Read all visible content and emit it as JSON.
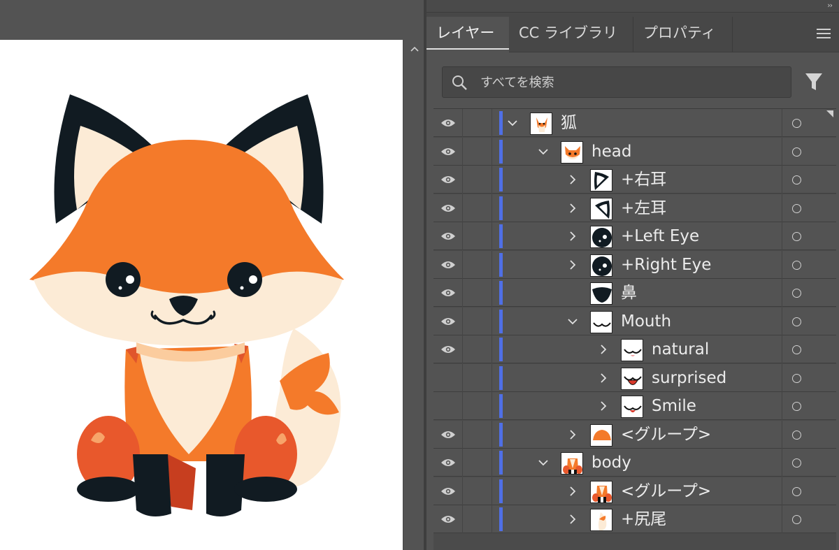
{
  "panel": {
    "tabs": [
      {
        "label": "レイヤー",
        "active": true
      },
      {
        "label": "CC ライブラリ",
        "active": false
      },
      {
        "label": "プロパティ",
        "active": false
      }
    ]
  },
  "search": {
    "placeholder": "すべてを検索"
  },
  "colors": {
    "layer_color": "#4f6fe6",
    "fox_orange": "#f47a2a",
    "fox_cream": "#fcebd6",
    "fox_dark": "#111b22"
  },
  "layers": [
    {
      "name": "狐",
      "depth": 0,
      "expand": "open",
      "visible": true,
      "thumb": "fox"
    },
    {
      "name": "head",
      "depth": 1,
      "expand": "open",
      "visible": true,
      "thumb": "head"
    },
    {
      "name": "+右耳",
      "depth": 2,
      "expand": "closed",
      "visible": true,
      "thumb": "ear-right"
    },
    {
      "name": "+左耳",
      "depth": 2,
      "expand": "closed",
      "visible": true,
      "thumb": "ear-left"
    },
    {
      "name": "+Left Eye",
      "depth": 2,
      "expand": "closed",
      "visible": true,
      "thumb": "eye"
    },
    {
      "name": "+Right Eye",
      "depth": 2,
      "expand": "closed",
      "visible": true,
      "thumb": "eye"
    },
    {
      "name": "鼻",
      "depth": 2,
      "expand": "none",
      "visible": true,
      "thumb": "nose"
    },
    {
      "name": "Mouth",
      "depth": 2,
      "expand": "open",
      "visible": true,
      "thumb": "mouth"
    },
    {
      "name": "natural",
      "depth": 3,
      "expand": "closed",
      "visible": true,
      "thumb": "mouth-natural"
    },
    {
      "name": "surprised",
      "depth": 3,
      "expand": "closed",
      "visible": false,
      "thumb": "mouth-surprised"
    },
    {
      "name": "Smile",
      "depth": 3,
      "expand": "closed",
      "visible": false,
      "thumb": "mouth-smile"
    },
    {
      "name": "<グループ>",
      "depth": 2,
      "expand": "closed",
      "visible": true,
      "thumb": "group-head"
    },
    {
      "name": "body",
      "depth": 1,
      "expand": "open",
      "visible": true,
      "thumb": "body"
    },
    {
      "name": "<グループ>",
      "depth": 2,
      "expand": "closed",
      "visible": true,
      "thumb": "group-body"
    },
    {
      "name": "+尻尾",
      "depth": 2,
      "expand": "closed",
      "visible": true,
      "thumb": "tail"
    }
  ]
}
